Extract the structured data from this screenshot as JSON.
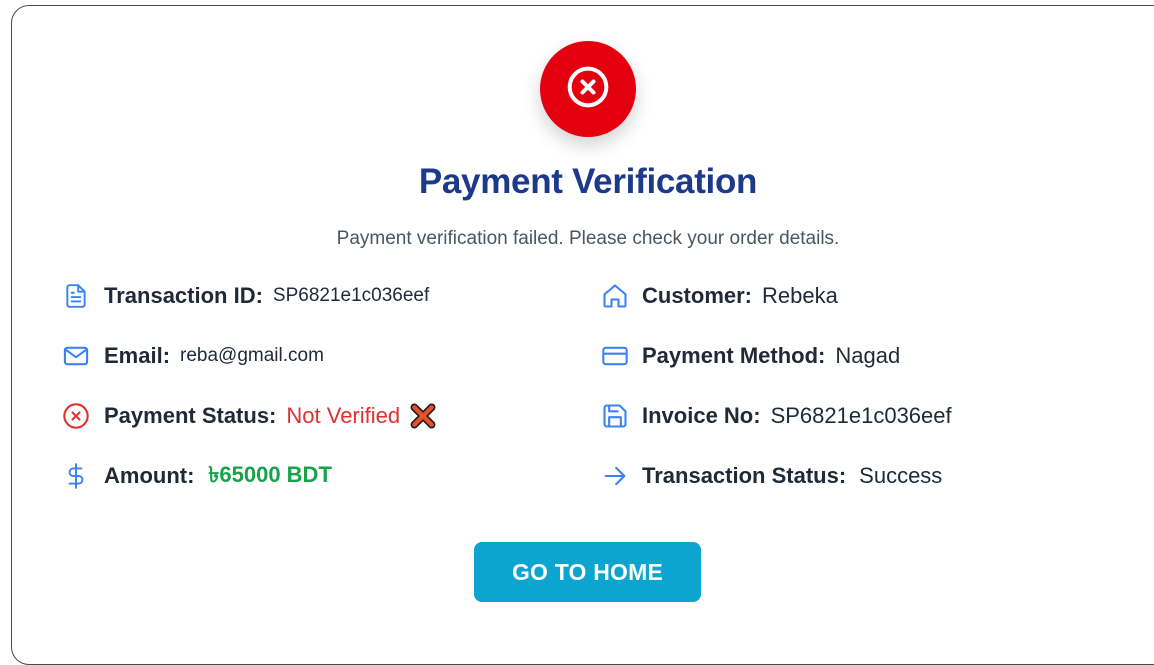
{
  "header": {
    "title": "Payment Verification",
    "subtitle": "Payment verification failed. Please check your order details.",
    "status_icon": "x-circle-icon"
  },
  "details": {
    "transaction_id": {
      "label": "Transaction ID:",
      "value": "SP6821e1c036eef"
    },
    "email": {
      "label": "Email:",
      "value": "reba@gmail.com"
    },
    "payment_status": {
      "label": "Payment Status:",
      "value": "Not Verified"
    },
    "amount": {
      "label": "Amount:",
      "value": "৳65000 BDT"
    },
    "customer": {
      "label": "Customer:",
      "value": "Rebeka"
    },
    "payment_method": {
      "label": "Payment Method:",
      "value": "Nagad"
    },
    "invoice_no": {
      "label": "Invoice No:",
      "value": "SP6821e1c036eef"
    },
    "transaction_status": {
      "label": "Transaction Status:",
      "value": "Success"
    }
  },
  "actions": {
    "home_button": "GO TO HOME"
  },
  "colors": {
    "error": "#e5000f",
    "title": "#1d3a8a",
    "icon": "#3b82f6",
    "amount": "#16a34a",
    "not_verified": "#e03131",
    "button": "#0ba5cf"
  }
}
